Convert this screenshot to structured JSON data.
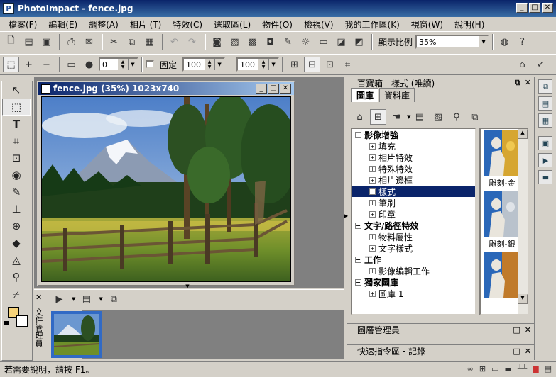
{
  "window": {
    "title": "PhotoImpact - fence.jpg",
    "min": "_",
    "max": "□",
    "close": "✕"
  },
  "menu": [
    "檔案(F)",
    "編輯(E)",
    "調整(A)",
    "相片 (T)",
    "特效(C)",
    "選取區(L)",
    "物件(O)",
    "檢視(V)",
    "我的工作區(K)",
    "視窗(W)",
    "說明(H)"
  ],
  "toolbar1": {
    "zoom_label": "顯示比例",
    "zoom_value": "35%"
  },
  "toolbar2": {
    "field1_value": "0",
    "fixed_label": "固定",
    "width_value": "100",
    "height_value": "100"
  },
  "document": {
    "title": "fence.jpg (35%) 1023x740"
  },
  "filemanager": {
    "vertical_label": "文件管理員"
  },
  "easypalette": {
    "title": "百寶箱 - 樣式 (唯讀)",
    "tabs": [
      "圖庫",
      "資料庫"
    ],
    "tree": [
      {
        "label": "影像增強",
        "type": "group"
      },
      {
        "label": "填充",
        "type": "item"
      },
      {
        "label": "相片特效",
        "type": "item"
      },
      {
        "label": "特殊特效",
        "type": "item"
      },
      {
        "label": "相片邊框",
        "type": "item"
      },
      {
        "label": "樣式",
        "type": "item",
        "selected": true
      },
      {
        "label": "筆刷",
        "type": "item"
      },
      {
        "label": "印章",
        "type": "item"
      },
      {
        "label": "文字/路徑特效",
        "type": "group"
      },
      {
        "label": "物料屬性",
        "type": "item"
      },
      {
        "label": "文字樣式",
        "type": "item"
      },
      {
        "label": "工作",
        "type": "group"
      },
      {
        "label": "影像編輯工作",
        "type": "item"
      },
      {
        "label": "獨家圖庫",
        "type": "group"
      },
      {
        "label": "圖庫 1",
        "type": "item"
      }
    ],
    "previews": [
      "雕刻-金",
      "雕刻-銀",
      ""
    ]
  },
  "layer_manager": {
    "title": "圖層管理員"
  },
  "quick_command": {
    "title": "快速指令區 - 記錄"
  },
  "status": {
    "text": "若需要說明，請按 F1。"
  },
  "colors": {
    "title_bar": "#0a246a",
    "selection": "#0a246a",
    "foreground_swatch": "#f5d27a"
  }
}
